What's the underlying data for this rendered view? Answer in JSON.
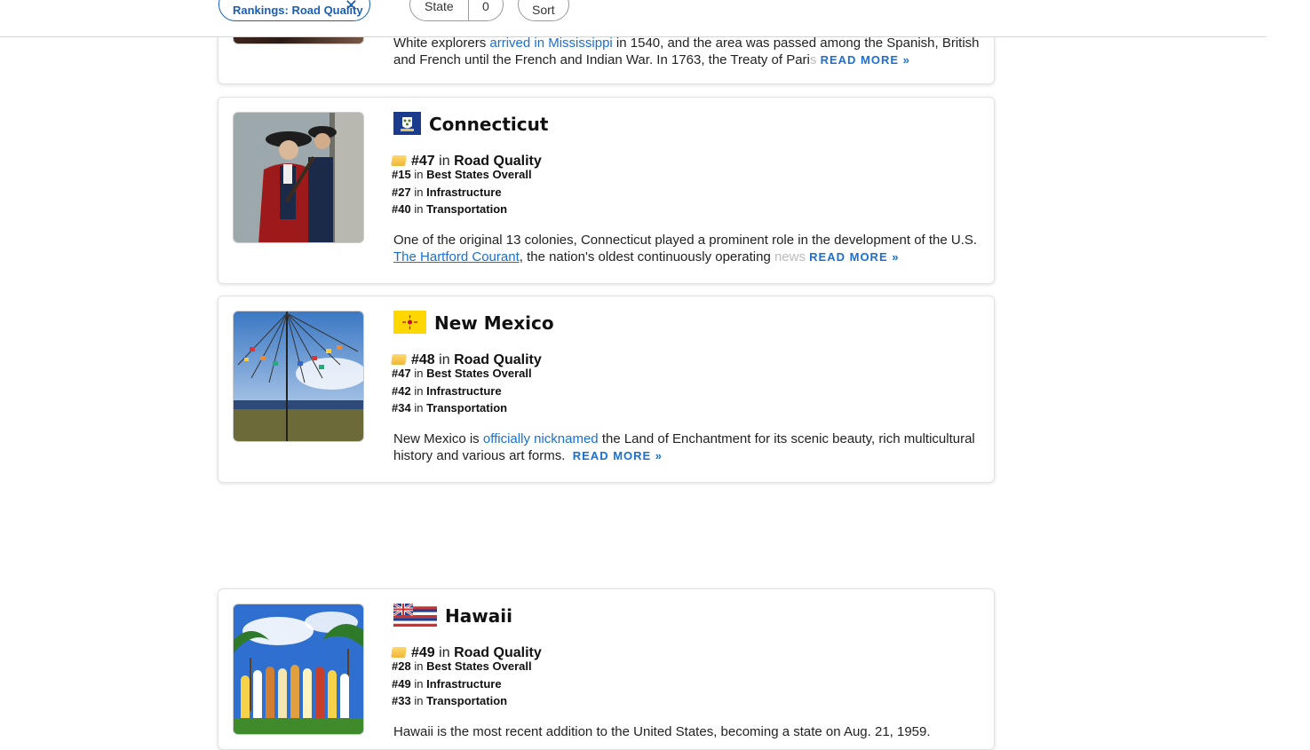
{
  "filters": {
    "ranking_chip": "Rankings: Road Quality",
    "state_label": "State",
    "state_count": "0",
    "sort_label": "Sort"
  },
  "cards": [
    {
      "desc_part1": "White explorers ",
      "desc_link": "arrived in Mississippi",
      "desc_part2": " in 1540, and the area was passed among the Spanish, British and French until the French and Indian War. In 1763, the Treaty of Pari",
      "desc_fade": "s",
      "read_more": "READ MORE »"
    },
    {
      "name": "Connecticut",
      "main_rank": "#47",
      "main_in": "in",
      "main_category": "Road Quality",
      "ranks": [
        {
          "rank": "#15",
          "in": "in",
          "category": "Best States Overall"
        },
        {
          "rank": "#27",
          "in": "in",
          "category": "Infrastructure"
        },
        {
          "rank": "#40",
          "in": "in",
          "category": "Transportation"
        }
      ],
      "desc_part1": "One of the original 13 colonies, Connecticut played a prominent role in the development of the U.S. ",
      "desc_link": "The Hartford Courant",
      "desc_part2": ", the nation's oldest continuously operating ",
      "desc_fade": "news",
      "read_more": "READ MORE »"
    },
    {
      "name": "New Mexico",
      "main_rank": "#48",
      "main_in": "in",
      "main_category": "Road Quality",
      "ranks": [
        {
          "rank": "#47",
          "in": "in",
          "category": "Best States Overall"
        },
        {
          "rank": "#42",
          "in": "in",
          "category": "Infrastructure"
        },
        {
          "rank": "#34",
          "in": "in",
          "category": "Transportation"
        }
      ],
      "desc_part1": "New Mexico is ",
      "desc_link": "officially nicknamed",
      "desc_part2": " the Land of Enchantment for its scenic beauty, rich multicultural history and various art forms.",
      "read_more": "READ MORE »"
    },
    {
      "name": "Hawaii",
      "main_rank": "#49",
      "main_in": "in",
      "main_category": "Road Quality",
      "ranks": [
        {
          "rank": "#28",
          "in": "in",
          "category": "Best States Overall"
        },
        {
          "rank": "#49",
          "in": "in",
          "category": "Infrastructure"
        },
        {
          "rank": "#33",
          "in": "in",
          "category": "Transportation"
        }
      ],
      "desc_part1": "Hawaii is the most recent addition to the United States, becoming a state on Aug. 21, 1959."
    }
  ],
  "colors": {
    "link": "#1a6fd4",
    "chip_accent": "#1a5fb4",
    "medal": "#f0b63a"
  }
}
